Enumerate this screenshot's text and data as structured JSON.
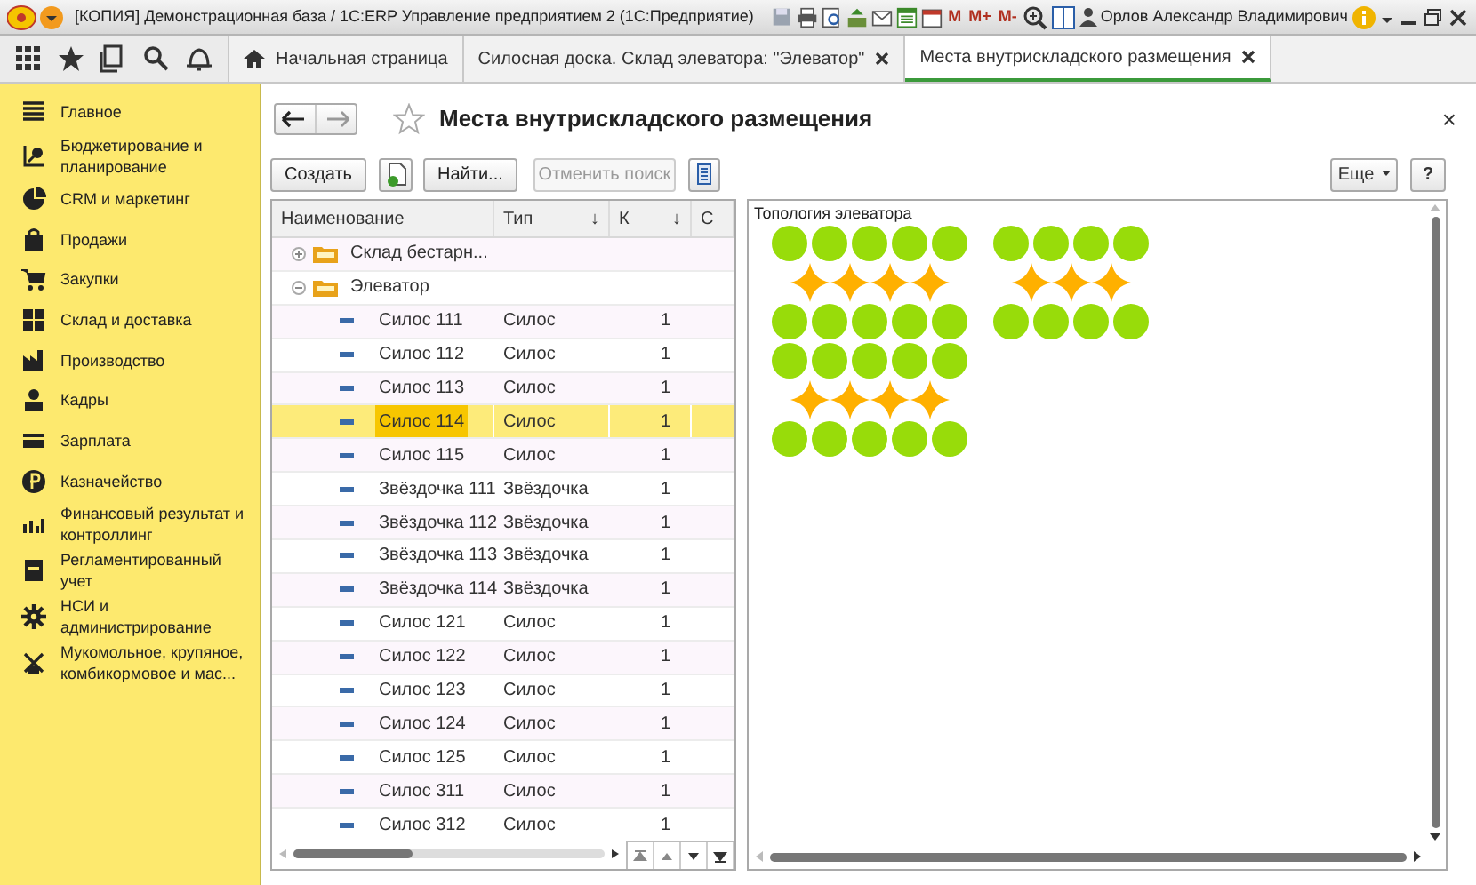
{
  "window": {
    "title": "[КОПИЯ] Демонстрационная база / 1С:ERP Управление предприятием 2  (1С:Предприятие)",
    "memory_buttons": [
      "M",
      "M+",
      "M-"
    ],
    "user": "Орлов Александр Владимирович"
  },
  "tabs": [
    {
      "label": "Начальная страница",
      "kind": "home",
      "closable": false,
      "selected": false
    },
    {
      "label": "Силосная доска. Склад элеватора: \"Элеватор\"",
      "kind": "page",
      "closable": true,
      "selected": false
    },
    {
      "label": "Места внутрискладского размещения",
      "kind": "page",
      "closable": true,
      "selected": true
    }
  ],
  "sidebar": {
    "items": [
      {
        "label": "Главное"
      },
      {
        "label": "Бюджетирование и планирование"
      },
      {
        "label": "CRM и маркетинг"
      },
      {
        "label": "Продажи"
      },
      {
        "label": "Закупки"
      },
      {
        "label": "Склад и доставка"
      },
      {
        "label": "Производство"
      },
      {
        "label": "Кадры"
      },
      {
        "label": "Зарплата"
      },
      {
        "label": "Казначейство"
      },
      {
        "label": "Финансовый результат и контроллинг"
      },
      {
        "label": "Регламентированный учет"
      },
      {
        "label": "НСИ и администрирование"
      },
      {
        "label": "Мукомольное, крупяное, комбикормовое и мас..."
      }
    ]
  },
  "form": {
    "title": "Места внутрискладского размещения",
    "close": "×",
    "toolbar": [
      {
        "label": "Создать",
        "kind": "text",
        "disabled": false
      },
      {
        "kind": "copy",
        "disabled": false
      },
      {
        "label": "Найти...",
        "kind": "text",
        "disabled": false
      },
      {
        "label": "Отменить поиск",
        "kind": "text",
        "disabled": true
      },
      {
        "kind": "list",
        "disabled": false
      }
    ],
    "more_button": "Еще",
    "help_button": "?",
    "table": {
      "columns": [
        {
          "label": "Наименование"
        },
        {
          "label": "Тип",
          "sort_mark": "↓"
        },
        {
          "label": "К",
          "sort_mark": "↓"
        },
        {
          "label": "С"
        }
      ],
      "rows": [
        {
          "name": "Склад бестарн...",
          "kind": "group",
          "expanded": false,
          "selected": false
        },
        {
          "name": "Элеватор",
          "kind": "group",
          "expanded": true,
          "selected": false,
          "children": [
            {
              "name": "Силос 111",
              "type": "Силос",
              "k": "1",
              "selected": false
            },
            {
              "name": "Силос 112",
              "type": "Силос",
              "k": "1",
              "selected": false
            },
            {
              "name": "Силос 113",
              "type": "Силос",
              "k": "1",
              "selected": false
            },
            {
              "name": "Силос 114",
              "type": "Силос",
              "k": "1",
              "selected": true
            },
            {
              "name": "Силос 115",
              "type": "Силос",
              "k": "1",
              "selected": false
            },
            {
              "name": "Звёздочка 111",
              "type": "Звёздочка",
              "k": "1",
              "selected": false
            },
            {
              "name": "Звёздочка 112",
              "type": "Звёздочка",
              "k": "1",
              "selected": false
            },
            {
              "name": "Звёздочка 113",
              "type": "Звёздочка",
              "k": "1",
              "selected": false
            },
            {
              "name": "Звёздочка 114",
              "type": "Звёздочка",
              "k": "1",
              "selected": false
            },
            {
              "name": "Силос 121",
              "type": "Силос",
              "k": "1",
              "selected": false
            },
            {
              "name": "Силос 122",
              "type": "Силос",
              "k": "1",
              "selected": false
            },
            {
              "name": "Силос 123",
              "type": "Силос",
              "k": "1",
              "selected": false
            },
            {
              "name": "Силос 124",
              "type": "Силос",
              "k": "1",
              "selected": false
            },
            {
              "name": "Силос 125",
              "type": "Силос",
              "k": "1",
              "selected": false
            },
            {
              "name": "Силос 311",
              "type": "Силос",
              "k": "1",
              "selected": false
            },
            {
              "name": "Силос 312",
              "type": "Силос",
              "k": "1",
              "selected": false
            }
          ]
        }
      ]
    },
    "topology": {
      "title": "Топология элеватора",
      "groups": [
        {
          "rows": [
            [
              {
                "kind": "silo"
              },
              {
                "kind": "silo"
              },
              {
                "kind": "silo"
              },
              {
                "kind": "silo"
              },
              {
                "kind": "silo"
              }
            ],
            [
              {
                "kind": "star"
              },
              {
                "kind": "star"
              },
              {
                "kind": "star"
              },
              {
                "kind": "star"
              }
            ],
            [
              {
                "kind": "silo"
              },
              {
                "kind": "silo"
              },
              {
                "kind": "silo"
              },
              {
                "kind": "silo"
              },
              {
                "kind": "silo"
              }
            ],
            [
              {
                "kind": "silo"
              },
              {
                "kind": "silo"
              },
              {
                "kind": "silo"
              },
              {
                "kind": "silo"
              },
              {
                "kind": "silo"
              }
            ],
            [
              {
                "kind": "star"
              },
              {
                "kind": "star"
              },
              {
                "kind": "star"
              },
              {
                "kind": "star"
              }
            ],
            [
              {
                "kind": "silo"
              },
              {
                "kind": "silo"
              },
              {
                "kind": "silo"
              },
              {
                "kind": "silo"
              },
              {
                "kind": "silo"
              }
            ]
          ]
        },
        {
          "rows": [
            [
              {
                "kind": "silo"
              },
              {
                "kind": "silo"
              },
              {
                "kind": "silo"
              },
              {
                "kind": "silo"
              }
            ],
            [
              {
                "kind": "star"
              },
              {
                "kind": "star"
              },
              {
                "kind": "star"
              }
            ],
            [
              {
                "kind": "silo"
              },
              {
                "kind": "silo"
              },
              {
                "kind": "silo"
              },
              {
                "kind": "silo"
              }
            ]
          ]
        }
      ]
    }
  }
}
